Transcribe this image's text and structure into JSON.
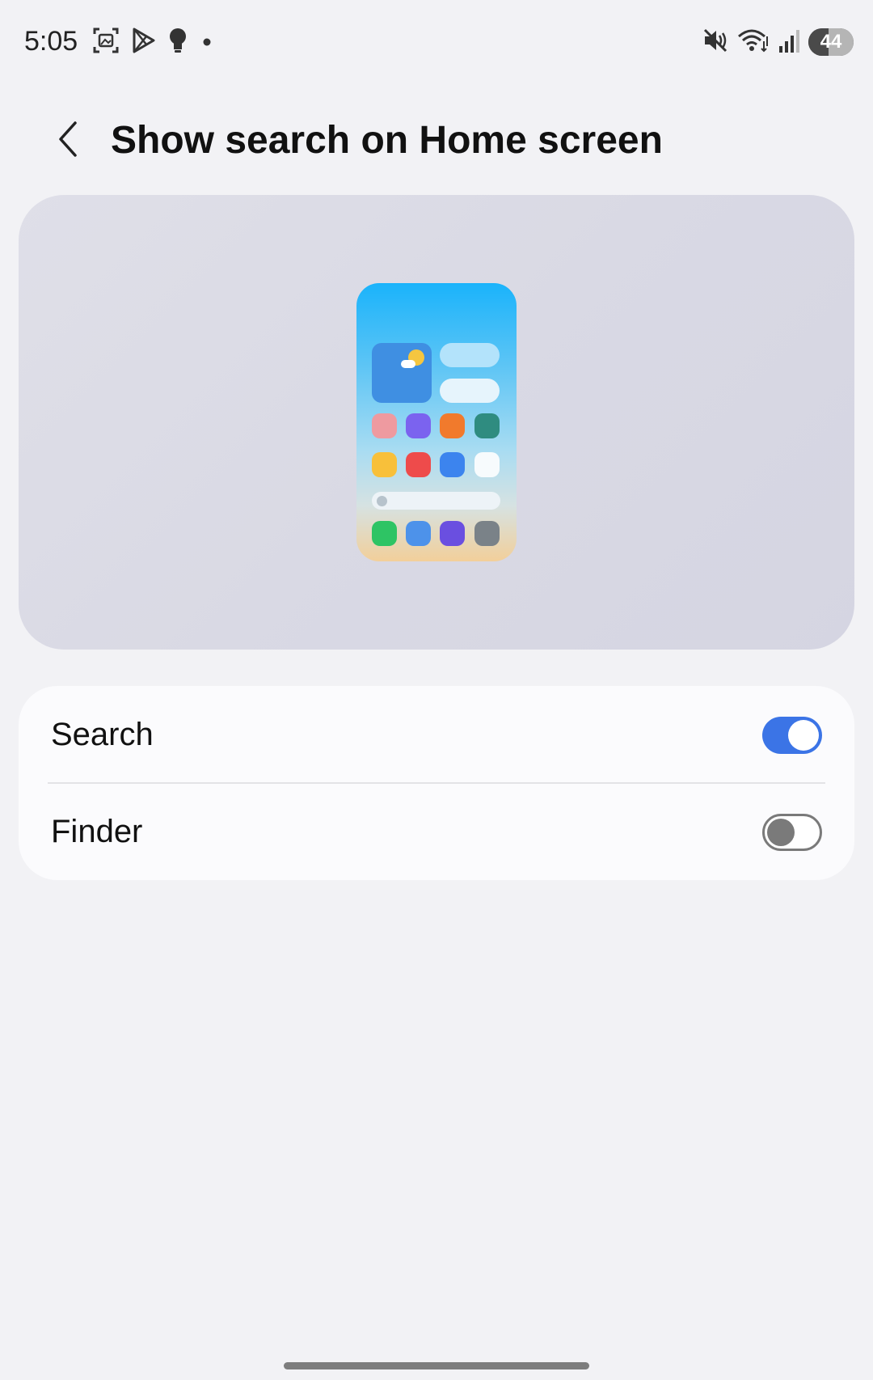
{
  "status_bar": {
    "time": "5:05",
    "left_icons": [
      "screenshot-icon",
      "play-store-icon",
      "lightbulb-icon",
      "notification-dot-icon"
    ],
    "right_icons": [
      "mute-icon",
      "wifi-icon",
      "signal-icon"
    ],
    "battery_level": "44"
  },
  "header": {
    "title": "Show search on Home screen",
    "back_icon": "chevron-left-icon"
  },
  "preview": {
    "illustration": "home-screen-phone-illustration",
    "app_icon_colors_row1": [
      "#ee9aa0",
      "#7b63ef",
      "#f17a2c",
      "#2f8c80"
    ],
    "app_icon_colors_row2": [
      "#f8c03a",
      "#ee4b4b",
      "#3c84ee",
      "#f7fbfd"
    ],
    "app_icon_colors_dock": [
      "#2ec464",
      "#4d92ea",
      "#6a4fe0",
      "#7a8288"
    ]
  },
  "settings": {
    "items": [
      {
        "label": "Search",
        "enabled": true
      },
      {
        "label": "Finder",
        "enabled": false
      }
    ],
    "accent_color": "#3b74e6"
  }
}
